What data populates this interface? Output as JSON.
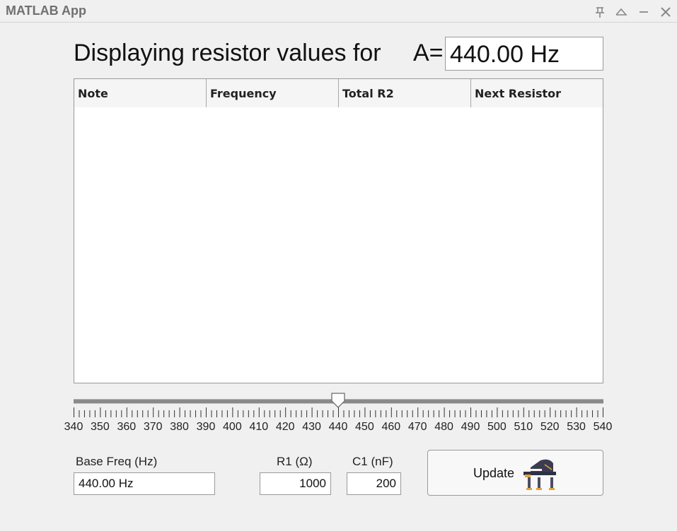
{
  "window": {
    "title": "MATLAB App"
  },
  "header": {
    "text": "Displaying resistor values for",
    "note_label": "A=",
    "freq_value": "440.00 Hz"
  },
  "table": {
    "columns": [
      "Note",
      "Frequency",
      "Total R2",
      "Next Resistor"
    ],
    "rows": []
  },
  "slider": {
    "min": 340,
    "max": 540,
    "value": 440,
    "tick_labels": [
      "340",
      "350",
      "360",
      "370",
      "380",
      "390",
      "400",
      "410",
      "420",
      "430",
      "440",
      "450",
      "460",
      "470",
      "480",
      "490",
      "500",
      "510",
      "520",
      "530",
      "540"
    ]
  },
  "controls": {
    "base_freq_label": "Base Freq (Hz)",
    "base_freq_value": "440.00 Hz",
    "r1_label": "R1 (Ω)",
    "r1_value": "1000",
    "c1_label": "C1 (nF)",
    "c1_value": "200",
    "update_label": "Update"
  },
  "icons": {
    "titlebar": [
      "pin-icon",
      "collapse-icon",
      "minimize-icon",
      "close-icon"
    ],
    "update": "piano-icon"
  },
  "colors": {
    "background": "#f0f0f0",
    "title_text": "#707070",
    "border": "#9a9a9a"
  }
}
